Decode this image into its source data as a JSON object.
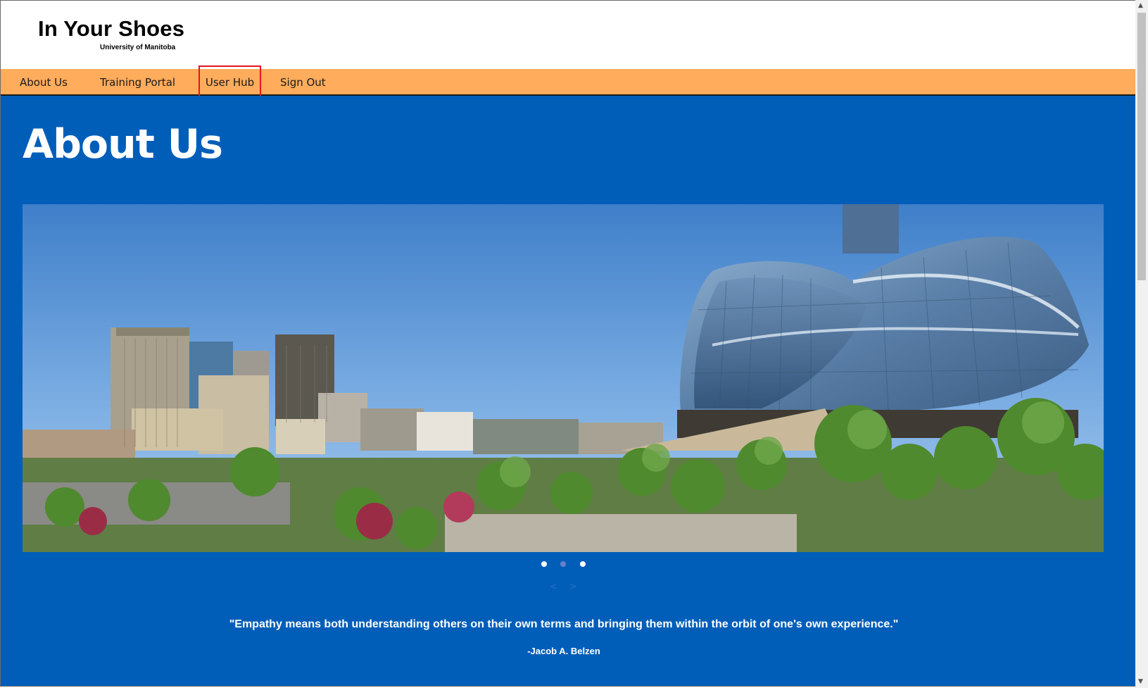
{
  "header": {
    "title": "In Your Shoes",
    "subtitle": "University of Manitoba"
  },
  "nav": {
    "items": [
      "About Us",
      "Training Portal",
      "User Hub",
      "Sign Out"
    ]
  },
  "main": {
    "heading": "About Us",
    "hero_image": "Winnipeg skyline with Canadian Museum for Human Rights",
    "carousel": {
      "active_slide": 1,
      "slide_count": 3,
      "prev_label": "<",
      "next_label": ">"
    },
    "quote": "\"Empathy means both understanding others on their own terms and bringing them within the orbit of one's own experience.\"",
    "author": "-Jacob A. Belzen"
  },
  "colors": {
    "nav_bg": "#ffac5c",
    "main_bg": "#005eb9",
    "highlight": "#e3161c"
  },
  "icons": {
    "scroll_up": "chevron-up-icon",
    "scroll_down": "chevron-down-icon"
  }
}
